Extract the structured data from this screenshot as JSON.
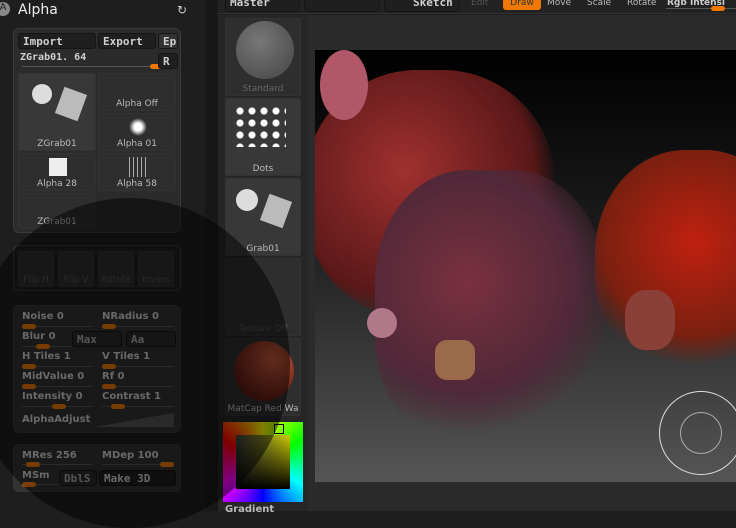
{
  "panel": {
    "title": "Alpha",
    "import": "Import",
    "export": "Export",
    "ep": "Ep",
    "current": "ZGrab01. 64",
    "r": "R",
    "thumbs": [
      "ZGrab01",
      "Alpha  Off",
      "Alpha  01",
      "Alpha  28",
      "Alpha  58",
      "ZGrab01"
    ],
    "tools": [
      "Flip H",
      "Flip V",
      "Rotate",
      "Invers"
    ],
    "noise": "Noise 0",
    "nradius": "NRadius 0",
    "blur": "Blur 0",
    "max": "Max",
    "aa": "Aa",
    "htiles": "H  Tiles 1",
    "vtiles": "V  Tiles 1",
    "midvalue": "MidValue 0",
    "rf": "Rf 0",
    "intensity": "Intensity 0",
    "contrast": "Contrast 1",
    "alphaadjust": "AlphaAdjust",
    "mres": "MRes 256",
    "mdep": "MDep 100",
    "msm": "MSm",
    "dbls": "DblS",
    "make3d": "Make  3D"
  },
  "shelf": {
    "items": [
      "Standard",
      "Dots",
      "Grab01",
      "Texture  Off",
      "MatCap  Red  Wa"
    ],
    "gradient": "Gradient"
  },
  "topbar": {
    "master": "Master",
    "sketch": "Sketch",
    "edit": "Edit",
    "draw": "Draw",
    "move": "Move",
    "scale": "Scale",
    "rotate": "Rotate",
    "rgb": "Rgb  Intensi"
  },
  "colors": {
    "accent": "#f07800"
  }
}
